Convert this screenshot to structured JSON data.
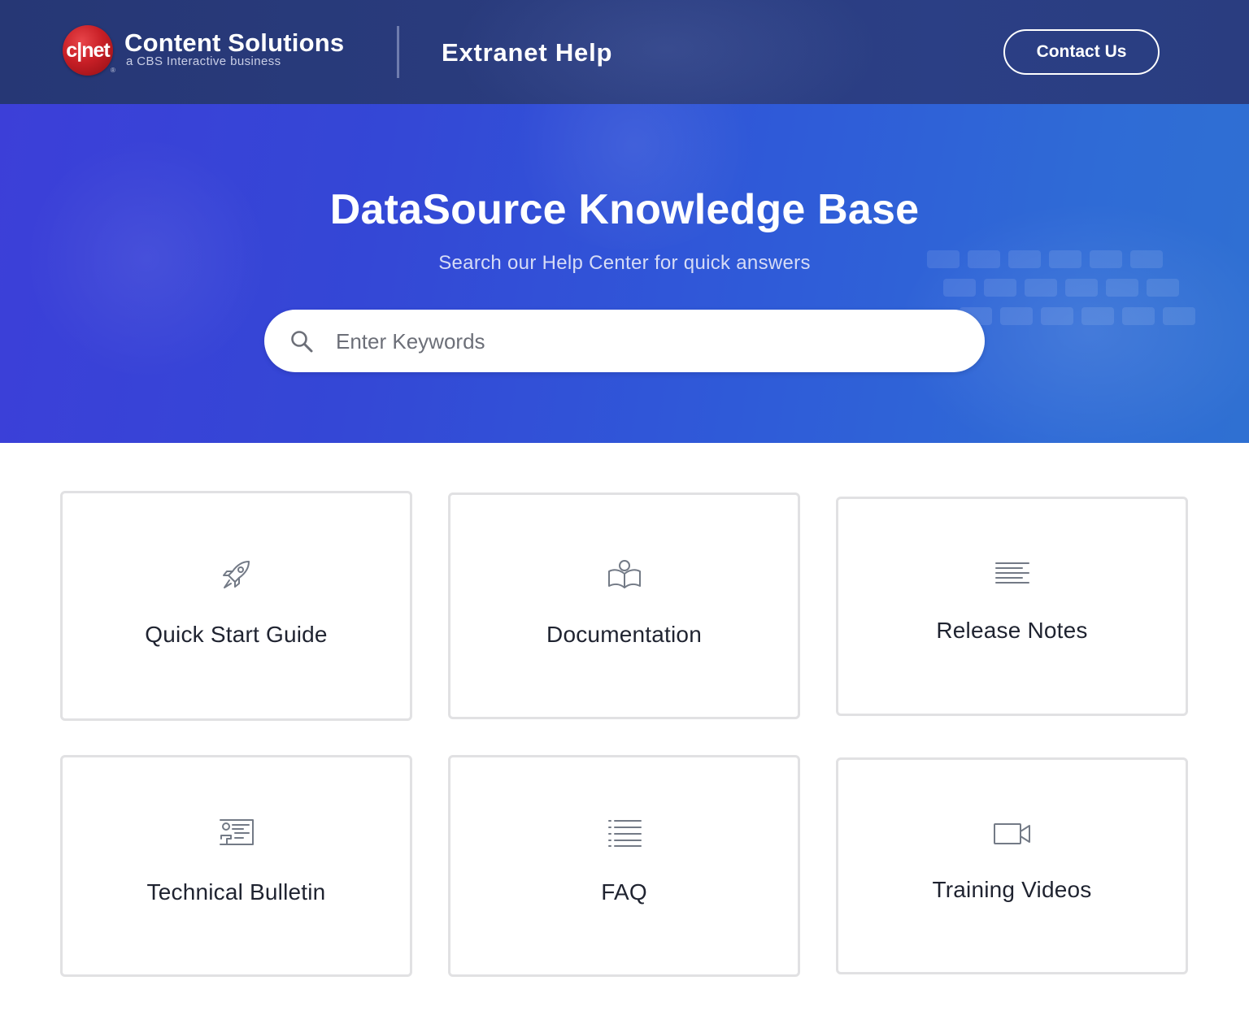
{
  "header": {
    "logo_text": "c|net",
    "brand_name": "Content Solutions",
    "brand_tagline": "a CBS Interactive business",
    "site_title": "Extranet Help",
    "contact_label": "Contact Us"
  },
  "hero": {
    "title": "DataSource Knowledge Base",
    "subtitle": "Search our Help Center for quick answers",
    "search_placeholder": "Enter Keywords"
  },
  "cards": [
    {
      "label": "Quick Start Guide",
      "icon": "rocket-icon"
    },
    {
      "label": "Documentation",
      "icon": "open-book-icon"
    },
    {
      "label": "Release Notes",
      "icon": "text-lines-icon"
    },
    {
      "label": "Technical Bulletin",
      "icon": "bulletin-icon"
    },
    {
      "label": "FAQ",
      "icon": "list-icon"
    },
    {
      "label": "Training Videos",
      "icon": "video-camera-icon"
    }
  ],
  "colors": {
    "header_bg": "#2a3c7e",
    "hero_gradient_start": "#3c3fd8",
    "hero_gradient_end": "#2f70d2",
    "logo_red": "#c81f26",
    "card_border": "#e1e1e3",
    "icon_gray": "#737a86"
  }
}
